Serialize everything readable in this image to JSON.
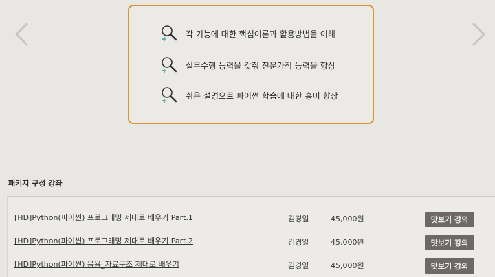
{
  "goals": [
    {
      "icon": "magnifier-plus-icon",
      "text": "각 기능에 대한 핵심이론과 활용방법을 이해"
    },
    {
      "icon": "magnifier-plus-icon",
      "text": "실무수행 능력을 갖춰 전문가적 능력을 향상"
    },
    {
      "icon": "magnifier-plus-icon",
      "text": "쉬운 설명으로 파이썬 학습에 대한 흥미 향상"
    }
  ],
  "package": {
    "title": "패키지 구성 강좌",
    "courses": [
      {
        "title": "[HD]Python(파이썬) 프로그래밍 제대로 배우기 Part.1",
        "teacher": "김경일",
        "price": "45,000원",
        "preview": "맛보기 강의"
      },
      {
        "title": "[HD]Python(파이썬) 프로그래밍 제대로 배우기 Part.2",
        "teacher": "김경일",
        "price": "45,000원",
        "preview": "맛보기 강의"
      },
      {
        "title": "[HD]Python(파이썬) 응용_자료구조 제대로 배우기",
        "teacher": "김경일",
        "price": "45,000원",
        "preview": "맛보기 강의"
      }
    ]
  },
  "colors": {
    "accent_border": "#d7962f",
    "background": "#e9e7e4",
    "button_bg": "#6e6966",
    "icon_plus": "#4fa7a5"
  }
}
